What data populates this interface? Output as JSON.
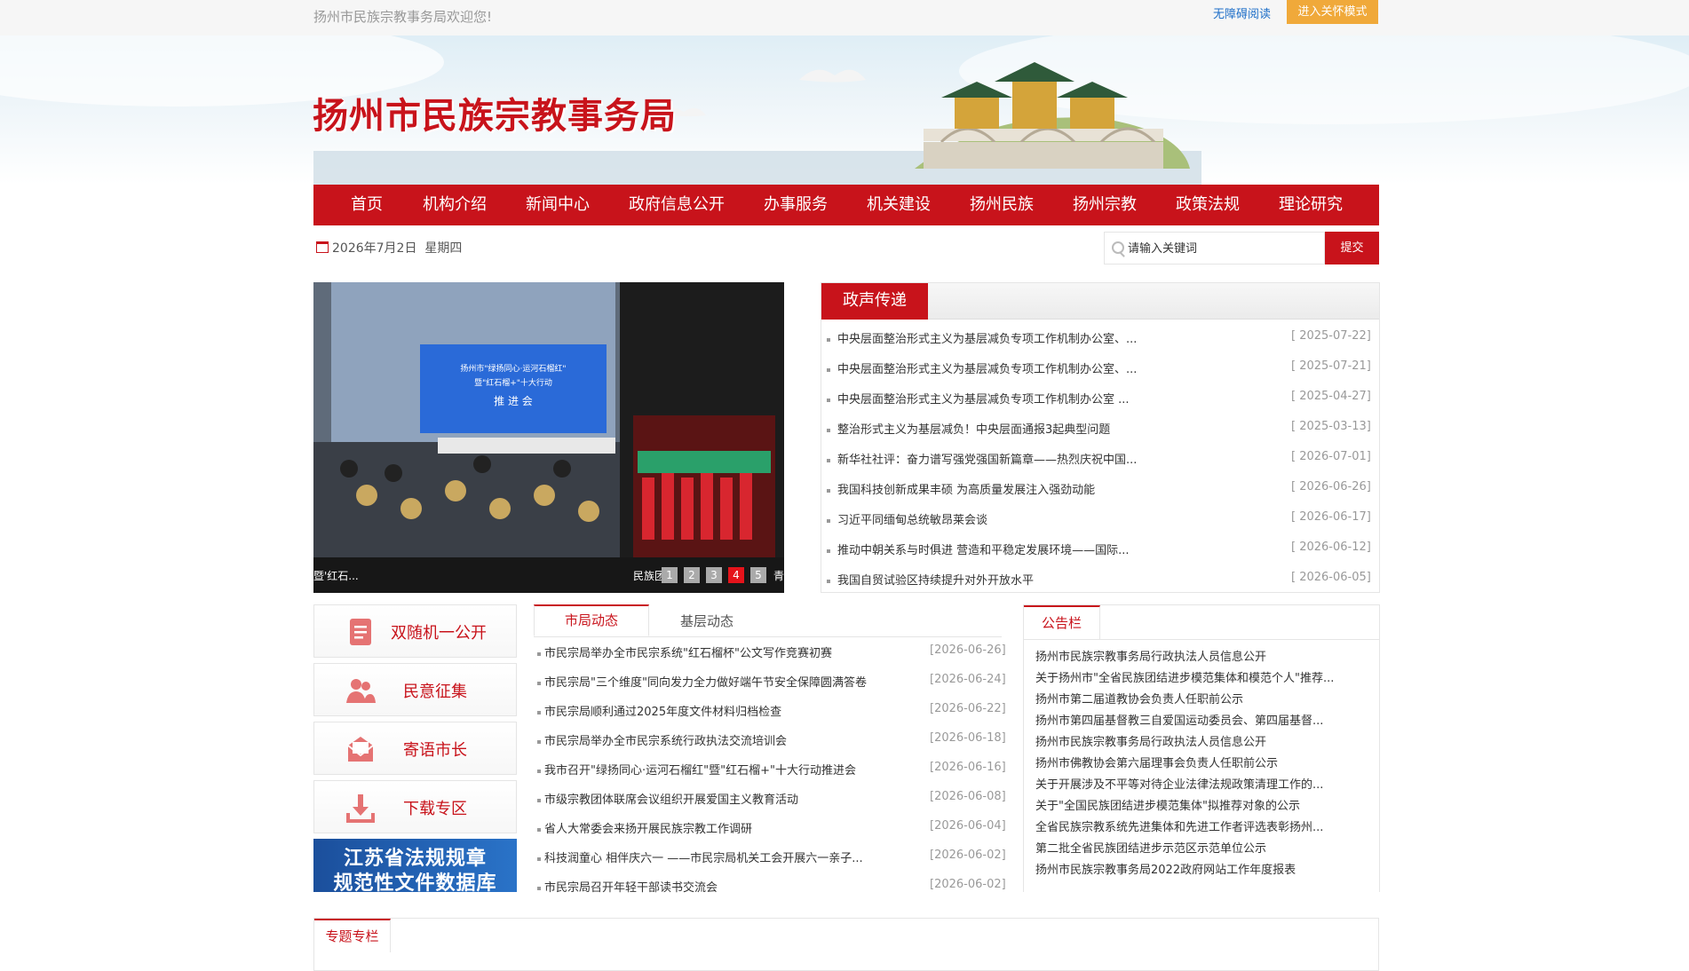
{
  "topbar": {
    "welcome": "扬州市民族宗教事务局欢迎您!",
    "accessible": "无障碍阅读",
    "care_mode": "进入关怀模式"
  },
  "header": {
    "site_title": "扬州市民族宗教事务局"
  },
  "nav": [
    "首页",
    "机构介绍",
    "新闻中心",
    "政府信息公开",
    "办事服务",
    "机关建设",
    "扬州民族",
    "扬州宗教",
    "政策法规",
    "理论研究"
  ],
  "datebar": {
    "date": "2026年7月2日",
    "weekday": "星期四"
  },
  "search": {
    "placeholder": "请输入关键词",
    "button": "提交"
  },
  "slider": {
    "caption_left": "暨'红石...",
    "caption_right": "民族团",
    "caption_edge": "青",
    "dots": [
      "1",
      "2",
      "3",
      "4",
      "5"
    ],
    "active_dot": 4,
    "banner_title_1": "扬州市\"绿扬同心·运河石榴红\"",
    "banner_title_2": "暨\"红石榴+\"十大行动",
    "banner_title_3": "推 进 会"
  },
  "news": {
    "tab": "政声传递",
    "items": [
      {
        "title": "中央层面整治形式主义为基层减负专项工作机制办公室、...",
        "date": "[ 2025-07-22]"
      },
      {
        "title": "中央层面整治形式主义为基层减负专项工作机制办公室、...",
        "date": "[ 2025-07-21]"
      },
      {
        "title": "中央层面整治形式主义为基层减负专项工作机制办公室 ...",
        "date": "[ 2025-04-27]"
      },
      {
        "title": "整治形式主义为基层减负！中央层面通报3起典型问题",
        "date": "[ 2025-03-13]"
      },
      {
        "title": "新华社社评：奋力谱写强党强国新篇章——热烈庆祝中国...",
        "date": "[ 2026-07-01]"
      },
      {
        "title": "我国科技创新成果丰硕 为高质量发展注入强劲动能",
        "date": "[ 2026-06-26]"
      },
      {
        "title": "习近平同缅甸总统敏昂莱会谈",
        "date": "[ 2026-06-17]"
      },
      {
        "title": "推动中朝关系与时俱进 营造和平稳定发展环境——国际...",
        "date": "[ 2026-06-12]"
      },
      {
        "title": "我国自贸试验区持续提升对外开放水平",
        "date": "[ 2026-06-05]"
      }
    ]
  },
  "quick_links": [
    {
      "label": "双随机一公开",
      "icon": "document-icon"
    },
    {
      "label": "民意征集",
      "icon": "users-icon"
    },
    {
      "label": "寄语市长",
      "icon": "mail-icon"
    },
    {
      "label": "下载专区",
      "icon": "download-icon"
    }
  ],
  "law_banner": {
    "line1": "江苏省法规规章",
    "line2": "规范性文件数据库"
  },
  "city_news": {
    "tab_active": "市局动态",
    "tab_other": "基层动态",
    "items": [
      {
        "title": "市民宗局举办全市民宗系统\"红石榴杯\"公文写作竞赛初赛",
        "date": "[2026-06-26]"
      },
      {
        "title": "市民宗局\"三个维度\"同向发力全力做好端午节安全保障圆满答卷",
        "date": "[2026-06-24]"
      },
      {
        "title": "市民宗局顺利通过2025年度文件材料归档检查",
        "date": "[2026-06-22]"
      },
      {
        "title": "市民宗局举办全市民宗系统行政执法交流培训会",
        "date": "[2026-06-18]"
      },
      {
        "title": "我市召开\"绿扬同心·运河石榴红\"暨\"红石榴+\"十大行动推进会",
        "date": "[2026-06-16]"
      },
      {
        "title": "市级宗教团体联席会议组织开展爱国主义教育活动",
        "date": "[2026-06-08]"
      },
      {
        "title": "省人大常委会来扬开展民族宗教工作调研",
        "date": "[2026-06-04]"
      },
      {
        "title": "科技润童心 相伴庆六一 ——市民宗局机关工会开展六一亲子...",
        "date": "[2026-06-02]"
      },
      {
        "title": "市民宗局召开年轻干部读书交流会",
        "date": "[2026-06-02]"
      }
    ]
  },
  "notices": {
    "tab": "公告栏",
    "items": [
      "扬州市民族宗教事务局行政执法人员信息公开",
      "关于扬州市\"全省民族团结进步模范集体和模范个人\"推荐...",
      "扬州市第二届道教协会负责人任职前公示",
      "扬州市第四届基督教三自爱国运动委员会、第四届基督...",
      "扬州市民族宗教事务局行政执法人员信息公开",
      "扬州市佛教协会第六届理事会负责人任职前公示",
      "关于开展涉及不平等对待企业法律法规政策清理工作的...",
      "关于\"全国民族团结进步模范集体\"拟推荐对象的公示",
      "全省民族宗教系统先进集体和先进工作者评选表彰扬州...",
      "第二批全省民族团结进步示范区示范单位公示",
      "扬州市民族宗教事务局2022政府网站工作年度报表"
    ]
  },
  "special": {
    "tab": "专题专栏"
  },
  "colors": {
    "brand_red": "#c8131b",
    "care_orange": "#f0a93a",
    "law_blue": "#1b4f9c"
  }
}
